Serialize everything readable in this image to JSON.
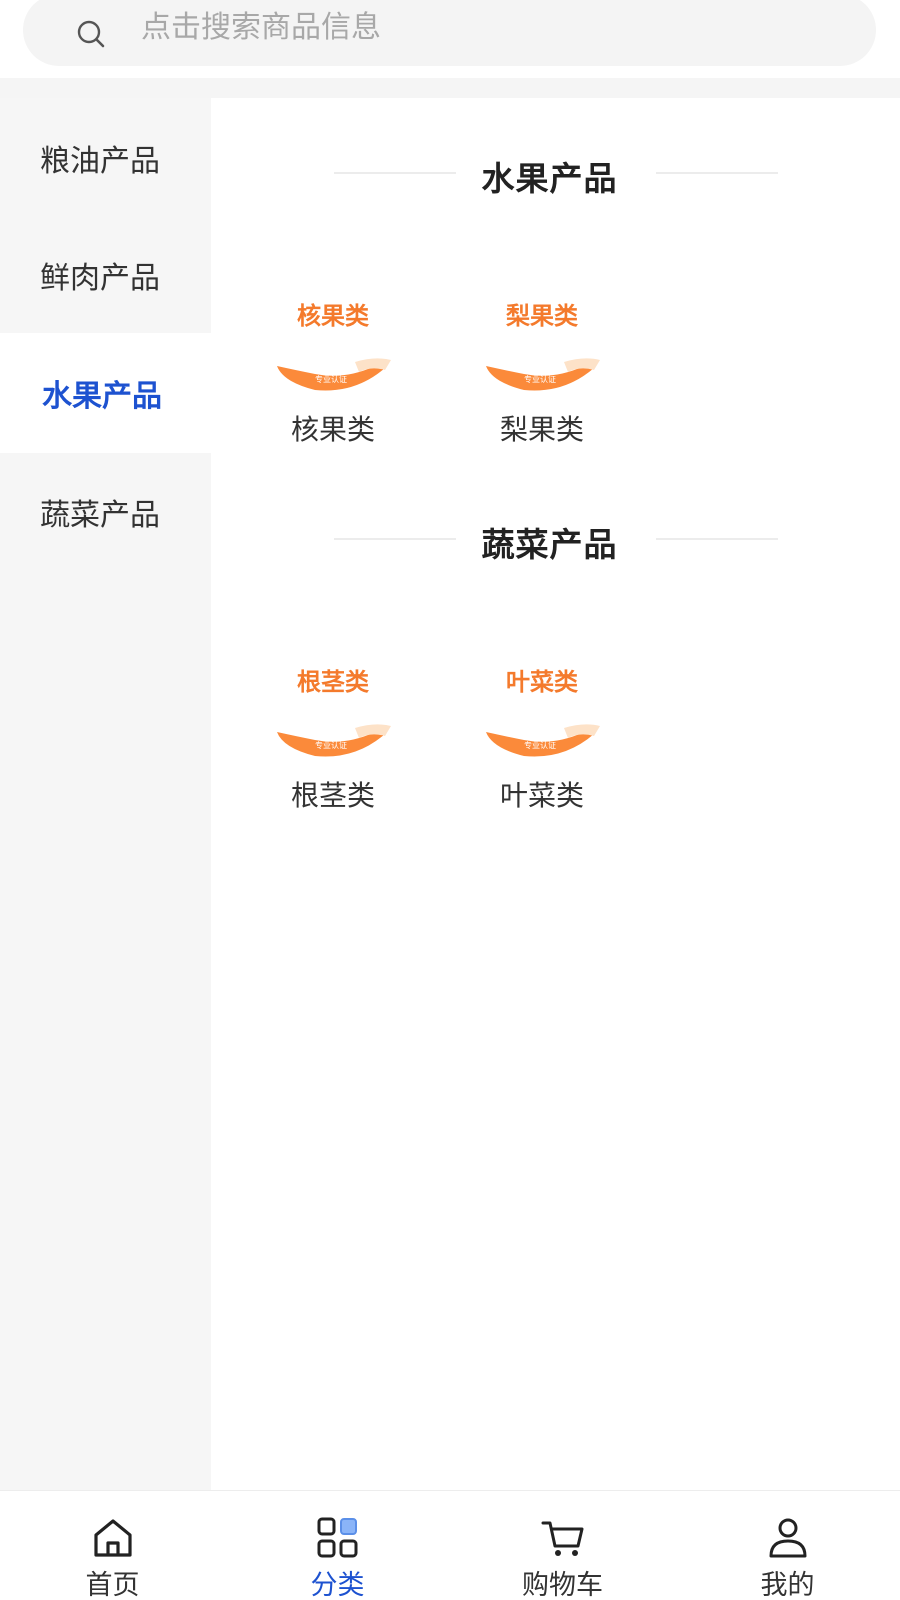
{
  "search": {
    "placeholder": "点击搜索商品信息"
  },
  "sidebar": {
    "items": [
      {
        "label": "粮油产品"
      },
      {
        "label": "鲜肉产品"
      },
      {
        "label": "水果产品"
      },
      {
        "label": "蔬菜产品"
      }
    ],
    "active_index": 2
  },
  "sections": [
    {
      "title": "水果产品",
      "items": [
        {
          "label": "核果类",
          "image_text": "核果类",
          "banner_text": "专业认证"
        },
        {
          "label": "梨果类",
          "image_text": "梨果类",
          "banner_text": "专业认证"
        }
      ]
    },
    {
      "title": "蔬菜产品",
      "items": [
        {
          "label": "根茎类",
          "image_text": "根茎类",
          "banner_text": "专业认证"
        },
        {
          "label": "叶菜类",
          "image_text": "叶菜类",
          "banner_text": "专业认证"
        }
      ]
    }
  ],
  "tabbar": {
    "items": [
      {
        "label": "首页",
        "icon": "home-icon"
      },
      {
        "label": "分类",
        "icon": "category-icon"
      },
      {
        "label": "购物车",
        "icon": "cart-icon"
      },
      {
        "label": "我的",
        "icon": "user-icon"
      }
    ],
    "active_index": 1
  },
  "colors": {
    "accent": "#1d52d0",
    "orange": "#f47a2c",
    "sidebar_bg": "#f6f6f6",
    "search_bg": "#f4f4f4"
  }
}
